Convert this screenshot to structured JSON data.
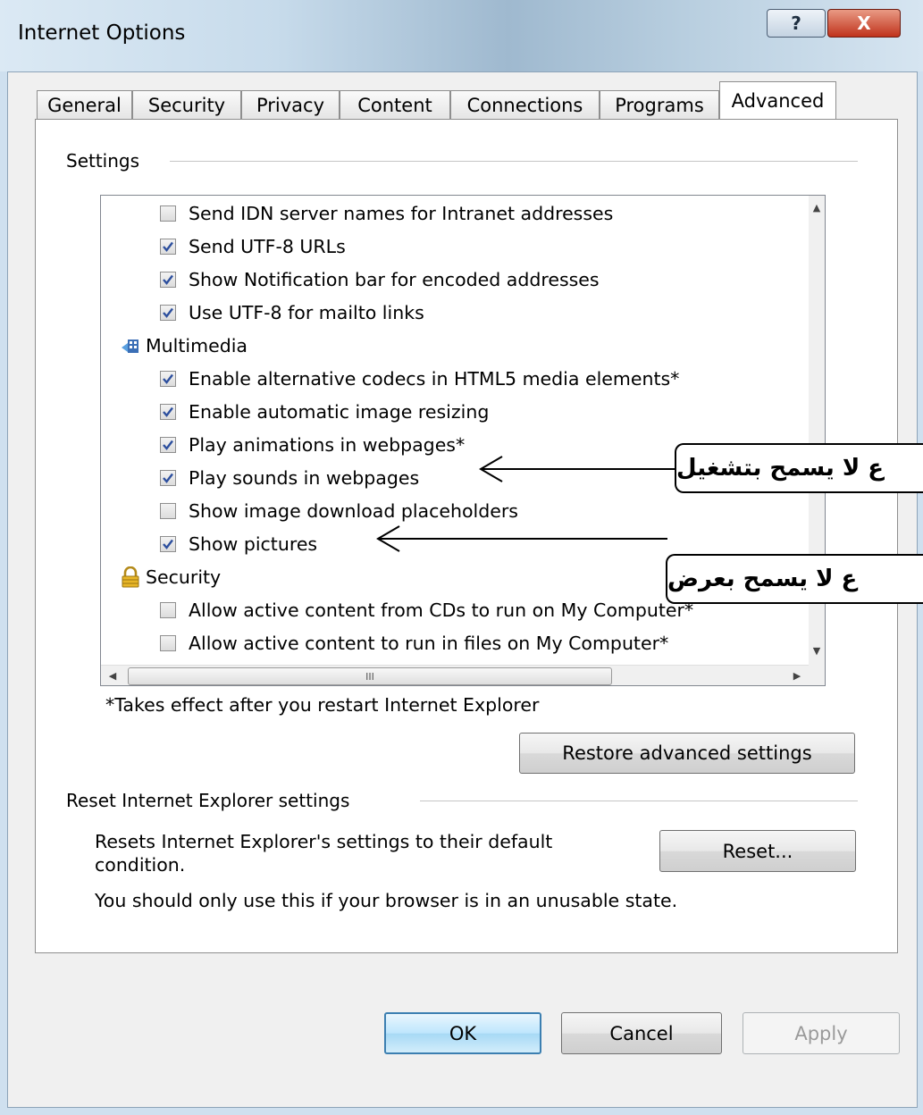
{
  "window": {
    "title": "Internet Options",
    "help_label": "?",
    "close_label": "X"
  },
  "tabs": [
    {
      "label": "General"
    },
    {
      "label": "Security"
    },
    {
      "label": "Privacy"
    },
    {
      "label": "Content"
    },
    {
      "label": "Connections"
    },
    {
      "label": "Programs"
    },
    {
      "label": "Advanced",
      "selected": true
    }
  ],
  "settings": {
    "group_label": "Settings",
    "rows": [
      {
        "type": "checkbox",
        "label": "Send IDN server names for Intranet addresses",
        "checked": false
      },
      {
        "type": "checkbox",
        "label": "Send UTF-8 URLs",
        "checked": true
      },
      {
        "type": "checkbox",
        "label": "Show Notification bar for encoded addresses",
        "checked": true
      },
      {
        "type": "checkbox",
        "label": "Use UTF-8 for mailto links",
        "checked": true
      },
      {
        "type": "category",
        "label": "Multimedia",
        "icon": "multimedia-icon"
      },
      {
        "type": "checkbox",
        "label": "Enable alternative codecs in HTML5 media elements*",
        "checked": true
      },
      {
        "type": "checkbox",
        "label": "Enable automatic image resizing",
        "checked": true
      },
      {
        "type": "checkbox",
        "label": "Play animations in webpages*",
        "checked": true
      },
      {
        "type": "checkbox",
        "label": "Play sounds in webpages",
        "checked": true
      },
      {
        "type": "checkbox",
        "label": "Show image download placeholders",
        "checked": false
      },
      {
        "type": "checkbox",
        "label": "Show pictures",
        "checked": true
      },
      {
        "type": "category",
        "label": "Security",
        "icon": "lock-icon"
      },
      {
        "type": "checkbox",
        "label": "Allow active content from CDs to run on My Computer*",
        "checked": false
      },
      {
        "type": "checkbox",
        "label": "Allow active content to run in files on My Computer*",
        "checked": false
      }
    ],
    "hscroll_grip": "III",
    "restart_note": "*Takes effect after you restart Internet Explorer",
    "restore_button": "Restore advanced settings"
  },
  "reset": {
    "group_label": "Reset Internet Explorer settings",
    "description_line1": "Resets Internet Explorer's settings to their default",
    "description_line2": "condition.",
    "warning": "You should only use this if your browser is in an unusable state.",
    "button": "Reset..."
  },
  "footer": {
    "ok": "OK",
    "cancel": "Cancel",
    "apply": "Apply"
  },
  "annotations": [
    {
      "text": "ع لا يسمح بتشغيل",
      "points_to": "Play sounds in webpages"
    },
    {
      "text": "ع لا يسمح بعرض",
      "points_to": "Show pictures"
    }
  ],
  "colors": {
    "default_button_border": "#3c7fb1",
    "checkmark": "#2d4f9e",
    "close_button": "#c0331c"
  }
}
